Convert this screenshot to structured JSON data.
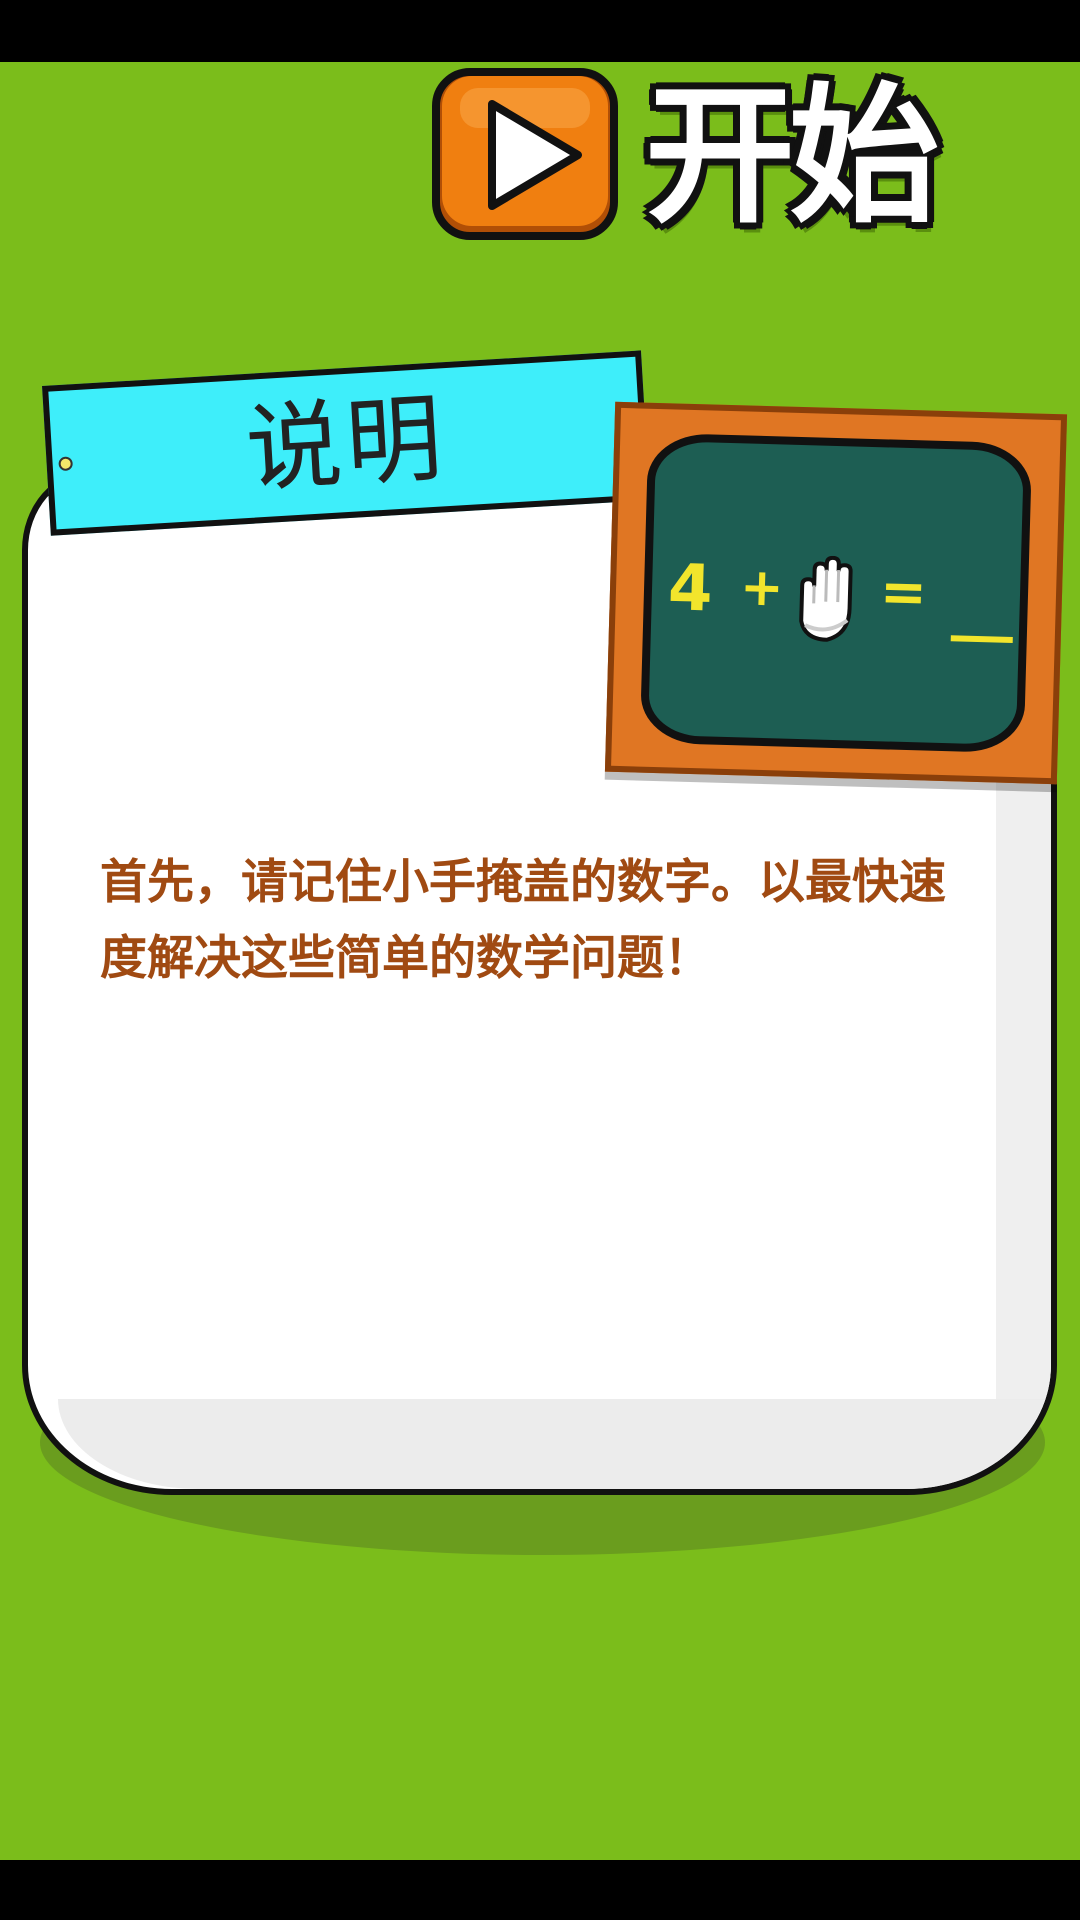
{
  "start_button": {
    "label": "开始",
    "icon": "play-icon"
  },
  "instructions": {
    "title": "说明",
    "body": "首先，请记住小手掩盖的数字。以最快速度解决这些简单的数学问题！",
    "example": {
      "number": "4",
      "operator": "+",
      "hidden_icon": "hand-icon",
      "equals": "="
    }
  },
  "colors": {
    "background": "#7bbd1b",
    "tab": "#3eeefa",
    "chalkboard": "#1d5e53",
    "frame": "#e07623",
    "chalk": "#f2e52c",
    "body_text": "#a04a12",
    "play_button": "#f07f10"
  }
}
